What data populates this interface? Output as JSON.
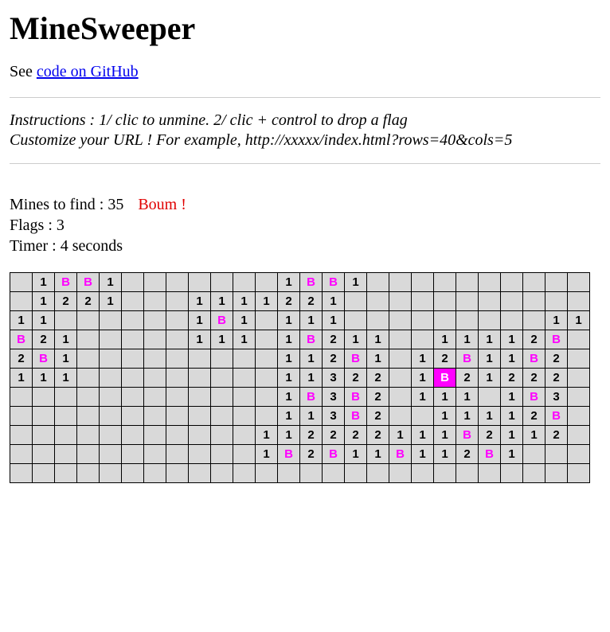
{
  "title": "MineSweeper",
  "seePrefix": "See ",
  "githubLink": "code on GitHub",
  "instructionsLine1": "Instructions : 1/ clic to unmine. 2/ clic + control to drop a flag",
  "instructionsLine2": "Customize your URL ! For example, http://xxxxx/index.html?rows=40&cols=5",
  "status": {
    "minesLabel": "Mines to find : ",
    "mines": "35",
    "boum": "Boum !",
    "flagsLabel": "Flags : ",
    "flags": "3",
    "timerLabel": "Timer : ",
    "timer": "4 seconds"
  },
  "grid": {
    "rows": 11,
    "cols": 26,
    "cells": [
      [
        "",
        "1",
        "B",
        "B",
        "1",
        "",
        "",
        "",
        "",
        "",
        "",
        "",
        "1",
        "B",
        "B",
        "1",
        "",
        "",
        "",
        "",
        "",
        "",
        "",
        "",
        "",
        ""
      ],
      [
        "",
        "1",
        "2",
        "2",
        "1",
        "",
        "",
        "",
        "1",
        "1",
        "1",
        "1",
        "2",
        "2",
        "1",
        "",
        "",
        "",
        "",
        "",
        "",
        "",
        "",
        "",
        "",
        ""
      ],
      [
        "1",
        "1",
        "",
        "",
        "",
        "",
        "",
        "",
        "1",
        "B",
        "1",
        "",
        "1",
        "1",
        "1",
        "",
        "",
        "",
        "",
        "",
        "",
        "",
        "",
        "",
        "1",
        "1"
      ],
      [
        "B",
        "2",
        "1",
        "",
        "",
        "",
        "",
        "",
        "1",
        "1",
        "1",
        "",
        "1",
        "B",
        "2",
        "1",
        "1",
        "",
        "",
        "1",
        "1",
        "1",
        "1",
        "2",
        "B",
        ""
      ],
      [
        "2",
        "B",
        "1",
        "",
        "",
        "",
        "",
        "",
        "",
        "",
        "",
        "",
        "1",
        "1",
        "2",
        "B",
        "1",
        "",
        "1",
        "2",
        "B",
        "1",
        "1",
        "B",
        "2",
        ""
      ],
      [
        "1",
        "1",
        "1",
        "",
        "",
        "",
        "",
        "",
        "",
        "",
        "",
        "",
        "1",
        "1",
        "3",
        "2",
        "2",
        "",
        "1",
        "B!",
        "2",
        "1",
        "2",
        "2",
        "2",
        ""
      ],
      [
        "",
        "",
        "",
        "",
        "",
        "",
        "",
        "",
        "",
        "",
        "",
        "",
        "1",
        "B",
        "3",
        "B",
        "2",
        "",
        "1",
        "1",
        "1",
        "",
        "1",
        "B",
        "3",
        ""
      ],
      [
        "",
        "",
        "",
        "",
        "",
        "",
        "",
        "",
        "",
        "",
        "",
        "",
        "1",
        "1",
        "3",
        "B",
        "2",
        "",
        "",
        "1",
        "1",
        "1",
        "1",
        "2",
        "B",
        ""
      ],
      [
        "",
        "",
        "",
        "",
        "",
        "",
        "",
        "",
        "",
        "",
        "",
        "1",
        "1",
        "2",
        "2",
        "2",
        "2",
        "1",
        "1",
        "1",
        "B",
        "2",
        "1",
        "1",
        "2",
        ""
      ],
      [
        "",
        "",
        "",
        "",
        "",
        "",
        "",
        "",
        "",
        "",
        "",
        "1",
        "B",
        "2",
        "B",
        "1",
        "1",
        "B",
        "1",
        "1",
        "2",
        "B",
        "1",
        "",
        "",
        ""
      ],
      [
        "",
        "",
        "",
        "",
        "",
        "",
        "",
        "",
        "",
        "",
        "",
        "",
        "",
        "",
        "",
        "",
        "",
        "",
        "",
        "",
        "",
        "",
        "",
        "",
        "",
        ""
      ]
    ]
  }
}
